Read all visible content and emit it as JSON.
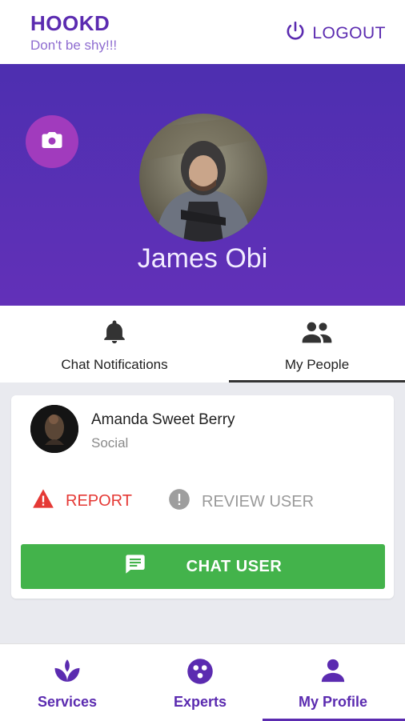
{
  "header": {
    "title": "HOOKD",
    "subtitle": "Don't be shy!!!",
    "logout_label": "LOGOUT",
    "brand_color": "#5b2bb0"
  },
  "profile": {
    "name": "James Obi"
  },
  "tabs": [
    {
      "label": "Chat Notifications",
      "icon": "bell-icon",
      "selected": false
    },
    {
      "label": "My People",
      "icon": "people-icon",
      "selected": true
    }
  ],
  "person": {
    "name": "Amanda Sweet Berry",
    "category": "Social",
    "report_label": "REPORT",
    "review_label": "REVIEW USER",
    "chat_label": "CHAT USER",
    "chat_color": "#43b34b",
    "report_color": "#e53935"
  },
  "bottom_nav": [
    {
      "label": "Services",
      "icon": "lotus-icon",
      "selected": false
    },
    {
      "label": "Experts",
      "icon": "experts-icon",
      "selected": false
    },
    {
      "label": "My Profile",
      "icon": "person-icon",
      "selected": true
    }
  ]
}
